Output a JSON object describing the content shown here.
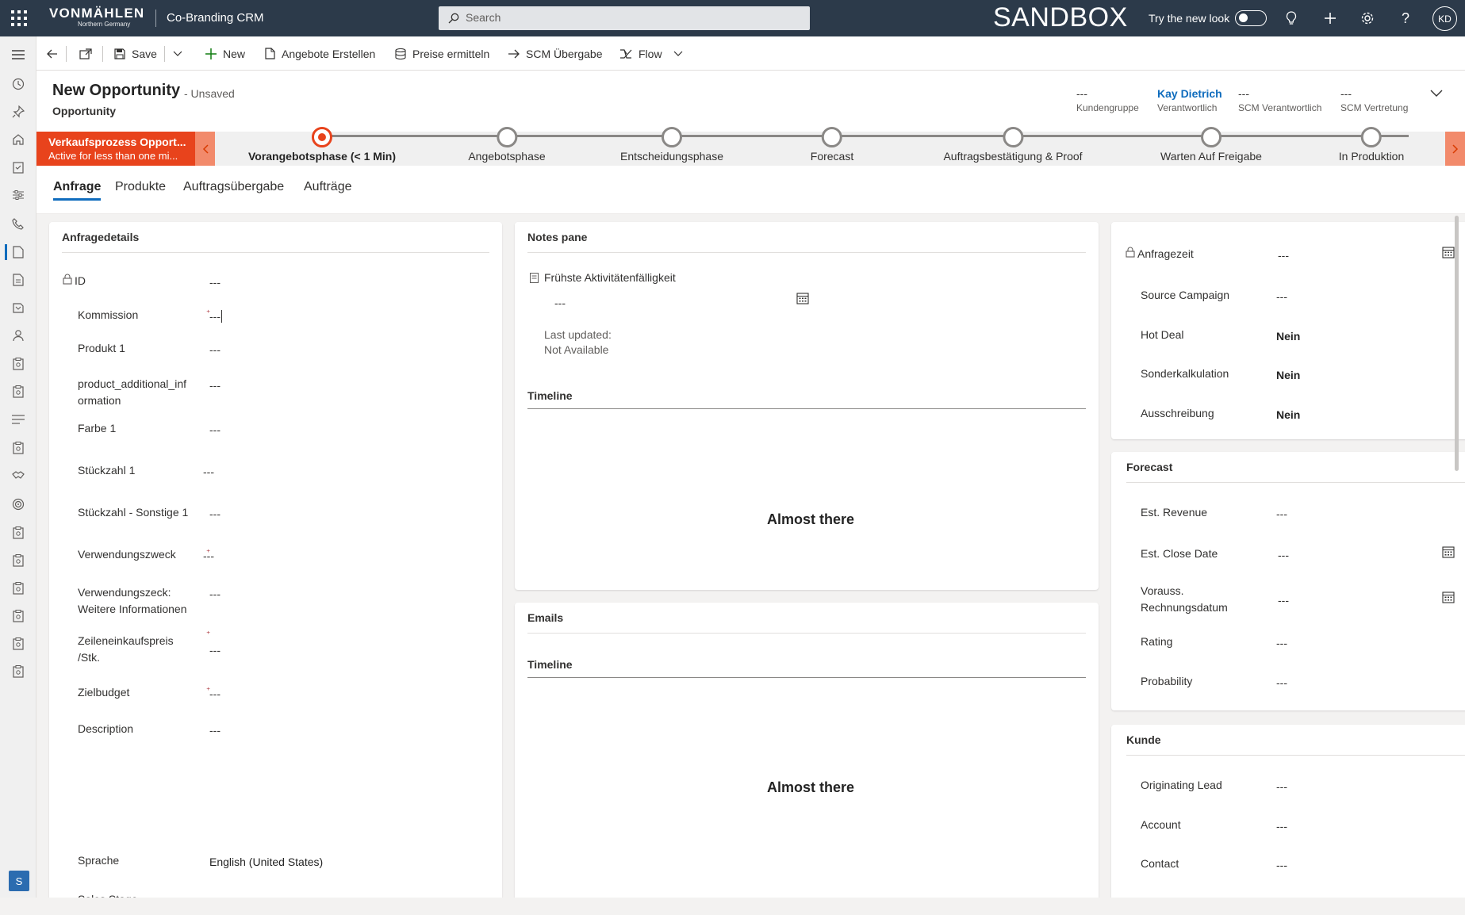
{
  "topbar": {
    "logo": "VONMÄHLEN",
    "logo_sub": "Northern Germany",
    "app_name": "Co-Branding CRM",
    "search_placeholder": "Search",
    "environment": "SANDBOX",
    "try_new_look": "Try the new look",
    "avatar_initials": "KD",
    "icons": [
      "waffle-icon",
      "lightbulb-icon",
      "plus-icon",
      "gear-icon",
      "help-icon"
    ]
  },
  "leftnav": {
    "icons": [
      "hamburger-icon",
      "recent-icon",
      "pinned-icon",
      "home-icon",
      "clipboard-icon",
      "settings-sliders-icon",
      "phone-icon",
      "document-icon",
      "document-icon",
      "book-icon",
      "person-icon",
      "clipboard-icon",
      "clipboard-icon",
      "list-icon",
      "clipboard-icon",
      "handshake-icon",
      "target-icon",
      "clipboard-icon",
      "clipboard-icon",
      "clipboard-icon",
      "clipboard-icon",
      "clipboard-icon"
    ],
    "area_badge": "S"
  },
  "cmdbar": {
    "save": "Save",
    "new": "New",
    "angebote": "Angebote Erstellen",
    "preise": "Preise ermitteln",
    "scm": "SCM Übergabe",
    "flow": "Flow"
  },
  "header": {
    "title": "New Opportunity",
    "unsaved": "- Unsaved",
    "entity": "Opportunity",
    "fields": [
      {
        "value": "---",
        "label": "Kundengruppe"
      },
      {
        "value": "Kay Dietrich",
        "label": "Verantwortlich"
      },
      {
        "value": "---",
        "label": "SCM Verantwortlich"
      },
      {
        "value": "---",
        "label": "SCM Vertretung"
      }
    ]
  },
  "process": {
    "active_title": "Verkaufsprozess Opport...",
    "active_sub": "Active for less than one mi...",
    "stages": [
      {
        "label": "Vorangebotsphase  (< 1 Min)",
        "current": true
      },
      {
        "label": "Angebotsphase",
        "current": false
      },
      {
        "label": "Entscheidungsphase",
        "current": false
      },
      {
        "label": "Forecast",
        "current": false
      },
      {
        "label": "Auftragsbestätigung & Proof",
        "current": false
      },
      {
        "label": "Warten Auf Freigabe",
        "current": false
      },
      {
        "label": "In Produktion",
        "current": false
      }
    ]
  },
  "tabs": [
    "Anfrage",
    "Produkte",
    "Auftragsübergabe",
    "Aufträge"
  ],
  "anfrage": {
    "title": "Anfragedetails",
    "fields": [
      {
        "label": "ID",
        "value": "---"
      },
      {
        "label": "Kommission",
        "value": "---"
      },
      {
        "label": "Produkt 1",
        "value": "---"
      },
      {
        "label": "product_additional_inf",
        "label2": "ormation",
        "value": "---"
      },
      {
        "label": "Farbe 1",
        "value": "---"
      },
      {
        "label": "Stückzahl 1",
        "value": "---"
      },
      {
        "label": "Stückzahl - Sonstige 1",
        "value": "---"
      },
      {
        "label": "Verwendungszweck",
        "value": "---"
      },
      {
        "label": "Verwendungszeck:",
        "label2": "Weitere Informationen",
        "value": "---"
      },
      {
        "label": "Zeileneinkaufspreis",
        "label2": "/Stk.",
        "value": "---"
      },
      {
        "label": "Zielbudget",
        "value": "---"
      },
      {
        "label": "Description",
        "value": "---"
      },
      {
        "label": "Sprache",
        "value": "English (United States)"
      },
      {
        "label": "Sales Stage",
        "value": "---"
      }
    ]
  },
  "notes": {
    "title": "Notes pane",
    "activity_label": "Frühste Aktivitätenfälligkeit",
    "activity_value": "---",
    "last_updated": "Last updated:",
    "not_available": "Not Available",
    "timeline": "Timeline",
    "almost": "Almost there"
  },
  "emails": {
    "title": "Emails",
    "timeline": "Timeline",
    "almost": "Almost there"
  },
  "right": {
    "fields": [
      {
        "label": "Anfragezeit",
        "value": "---"
      },
      {
        "label": "Source Campaign",
        "value": "---"
      },
      {
        "label": "Hot Deal",
        "value": "Nein"
      },
      {
        "label": "Sonderkalkulation",
        "value": "Nein"
      },
      {
        "label": "Ausschreibung",
        "value": "Nein"
      }
    ]
  },
  "forecast": {
    "title": "Forecast",
    "fields": [
      {
        "label": "Est. Revenue",
        "value": "---"
      },
      {
        "label": "Est. Close Date",
        "value": "---"
      },
      {
        "label": "Vorauss.",
        "label2": "Rechnungsdatum",
        "value": "---"
      },
      {
        "label": "Rating",
        "value": "---"
      },
      {
        "label": "Probability",
        "value": "---"
      }
    ]
  },
  "kunde": {
    "title": "Kunde",
    "fields": [
      {
        "label": "Originating Lead",
        "value": "---"
      },
      {
        "label": "Account",
        "value": "---"
      },
      {
        "label": "Contact",
        "value": "---"
      }
    ]
  },
  "colors": {
    "topbar": "#2c3a4a",
    "accent": "#0f6cbd",
    "process_active": "#e8431c"
  }
}
